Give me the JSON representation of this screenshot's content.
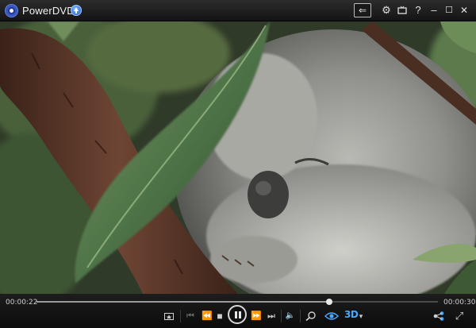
{
  "window": {
    "title": "PowerDVD",
    "icons": [
      "app-logo-icon",
      "update-icon",
      "back-arrow-icon",
      "settings-gear-icon",
      "tv-mode-icon",
      "help-icon",
      "minimize-icon",
      "maximize-icon",
      "close-icon"
    ],
    "buttons": {
      "back": "⇐",
      "settings": "⚙",
      "help": "?",
      "minimize": "–",
      "maximize": "☐",
      "close": "✕"
    }
  },
  "video": {
    "content": "koala-photo"
  },
  "playback": {
    "elapsed": "00:00:22",
    "duration": "00:00:30",
    "progress_fraction": 0.73
  },
  "controls": {
    "labels": {
      "previous": "⏮",
      "rewind": "⏪",
      "stop": "■",
      "forward": "⏩",
      "next": "⏭",
      "volume": "🔈",
      "three_d": "3D",
      "three_d_menu": "▾",
      "fullscreen": "⤢"
    },
    "icons": [
      "snapshot-icon",
      "previous-chapter-icon",
      "step-back-icon",
      "stop-icon",
      "pause-icon",
      "step-forward-icon",
      "next-chapter-icon",
      "volume-icon",
      "zoom-icon",
      "trueview-eye-icon",
      "3d-icon",
      "share-icon",
      "fullscreen-icon"
    ]
  },
  "colors": {
    "accent_blue": "#4aa8ff",
    "titlebar": "#1e1e1e",
    "control_bar": "#141414"
  }
}
